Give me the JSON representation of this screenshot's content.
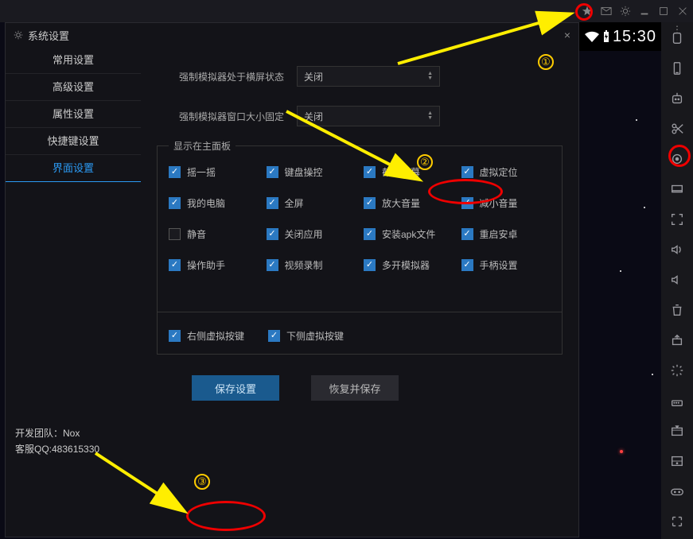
{
  "titlebar": {
    "icons": [
      "pin-icon",
      "mail-icon",
      "gear-icon",
      "minimize-icon",
      "maximize-icon",
      "close-icon"
    ]
  },
  "android_status": {
    "time": "15:30"
  },
  "right_sidebar": {
    "icons": [
      "rotate-icon",
      "phone-icon",
      "robot-icon",
      "scissors-icon",
      "location-icon",
      "display-icon",
      "fullscreen-icon",
      "volume-up-icon",
      "volume-down-icon",
      "trash-icon",
      "apk-icon",
      "loading-icon",
      "mouse-icon",
      "keyboard-drawer-icon",
      "drawer-icon",
      "gamepad-icon",
      "expand-icon"
    ]
  },
  "dialog": {
    "title": "系统设置",
    "close": "×",
    "nav": [
      "常用设置",
      "高级设置",
      "属性设置",
      "快捷键设置",
      "界面设置"
    ],
    "active_nav": 4,
    "footer": {
      "line1": "开发团队：Nox",
      "line2": "客服QQ:483615330"
    }
  },
  "form": {
    "row1": {
      "label": "强制模拟器处于横屏状态",
      "value": "关闭"
    },
    "row2": {
      "label": "强制模拟器窗口大小固定",
      "value": "关闭"
    }
  },
  "group1": {
    "title": "显示在主面板",
    "items": [
      {
        "label": "摇一摇",
        "checked": true
      },
      {
        "label": "键盘操控",
        "checked": true
      },
      {
        "label": "截取屏幕",
        "checked": true
      },
      {
        "label": "虚拟定位",
        "checked": true
      },
      {
        "label": "我的电脑",
        "checked": true
      },
      {
        "label": "全屏",
        "checked": true
      },
      {
        "label": "放大音量",
        "checked": true
      },
      {
        "label": "减小音量",
        "checked": true
      },
      {
        "label": "静音",
        "checked": false
      },
      {
        "label": "关闭应用",
        "checked": true
      },
      {
        "label": "安装apk文件",
        "checked": true
      },
      {
        "label": "重启安卓",
        "checked": true
      },
      {
        "label": "操作助手",
        "checked": true
      },
      {
        "label": "视频录制",
        "checked": true
      },
      {
        "label": "多开模拟器",
        "checked": true
      },
      {
        "label": "手柄设置",
        "checked": true
      }
    ]
  },
  "group2": {
    "items": [
      {
        "label": "右侧虚拟按键",
        "checked": true
      },
      {
        "label": "下侧虚拟按键",
        "checked": true
      }
    ]
  },
  "buttons": {
    "save": "保存设置",
    "restore": "恢复并保存"
  },
  "annotations": {
    "n1": "①",
    "n2": "②",
    "n3": "③"
  }
}
